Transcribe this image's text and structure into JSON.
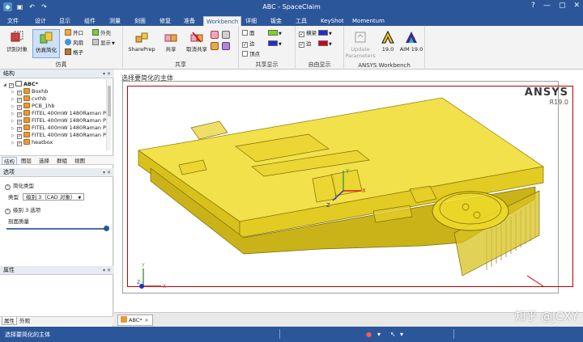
{
  "app": {
    "title": "ABC - SpaceClaim",
    "quick_access_icons": [
      "app-logo-icon",
      "save-icon",
      "undo-icon",
      "redo-icon"
    ],
    "window_buttons": [
      "?",
      "—",
      "▢",
      "✕"
    ]
  },
  "tabs": [
    "文件",
    "设计",
    "显示",
    "组件",
    "测量",
    "刻面",
    "修复",
    "准备",
    "Workbench",
    "详细",
    "钣金",
    "工具",
    "KeyShot",
    "Momentum"
  ],
  "active_tab": "Workbench",
  "ribbon": {
    "groups": {
      "simulation": {
        "label": "仿真",
        "identify": "识别对象",
        "simplify": "仿真简化",
        "small": [
          "开口",
          "外壳",
          "风扇",
          "显示",
          "格子"
        ]
      },
      "share": {
        "label": "共享",
        "shareprep": "SharePrep",
        "share": "共享",
        "unshare": "取消共享"
      },
      "share_display": {
        "label": "共享显示",
        "rows": [
          "面",
          "边",
          "顶点"
        ]
      },
      "free_display": {
        "label": "自由显示",
        "rows": [
          "横梁",
          "边"
        ]
      },
      "ansys_workbench": {
        "label": "ANSYS Workbench",
        "update": "Update Parameters",
        "v19": "19.0",
        "aim": "AIM 19.0"
      }
    },
    "colors": {
      "green": "#7ed321",
      "blue": "#1f2fd1",
      "gray": "#9b9b9b"
    }
  },
  "structure": {
    "title": "结构",
    "items": [
      {
        "label": "ABC*",
        "expanded": true
      },
      {
        "label": "Boxhb"
      },
      {
        "label": "cvrhb"
      },
      {
        "label": "PCB_1hb"
      },
      {
        "label": "FITEL 400mW 1480Raman P"
      },
      {
        "label": "FITEL 400mW 1480Raman P"
      },
      {
        "label": "FITEL 400mW 1480Raman P"
      },
      {
        "label": "FITEL 400mW 1480Raman P"
      },
      {
        "label": "heatbox"
      }
    ],
    "tabs": [
      "结构",
      "图层",
      "选择",
      "群组",
      "视图"
    ]
  },
  "options": {
    "title": "选项",
    "simplify_type": "简化类型",
    "type_label": "类型",
    "type_value": "级别 3（CAD 对象）",
    "level_options": "级别 3 选项",
    "section_quality": "剖面质量",
    "slider_value": 1.0
  },
  "properties": {
    "title": "属性",
    "tabs": [
      "属性",
      "外观"
    ]
  },
  "viewport": {
    "hint": "选择要简化的主体",
    "brand": "ANSYS",
    "version": "R19.0",
    "axis_labels": {
      "x": "X",
      "y": "Y",
      "z": "Z"
    },
    "model_color": "#e8cf1c"
  },
  "doc_tab": {
    "label": "ABC*"
  },
  "watermark": "知乎 @JCXY",
  "status": {
    "text": "选择要简化的主体"
  }
}
